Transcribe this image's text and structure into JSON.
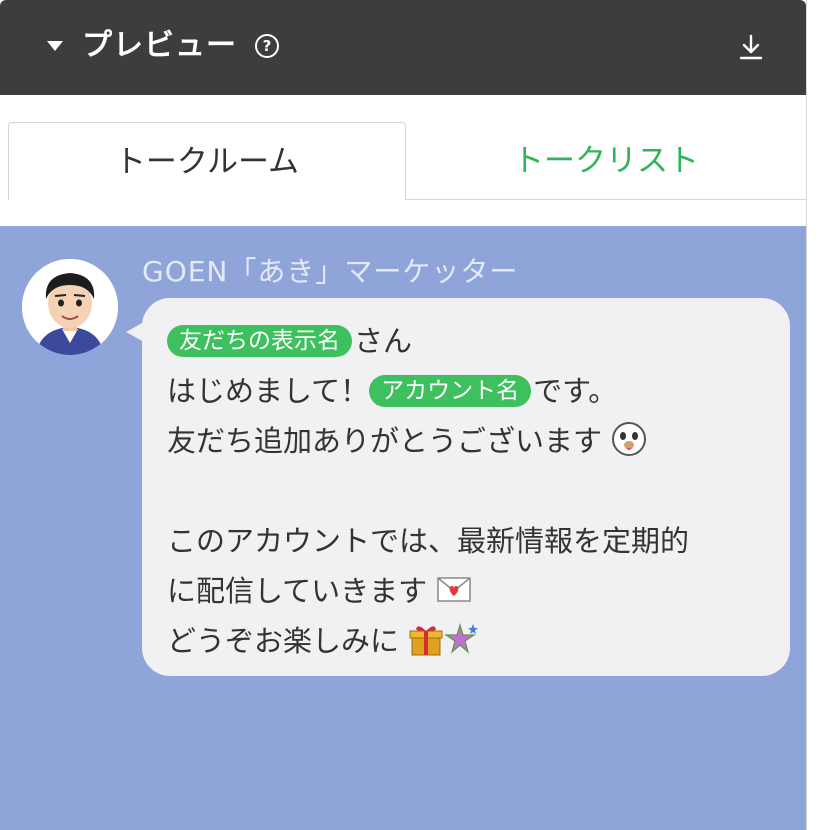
{
  "header": {
    "title": "プレビュー",
    "help_glyph": "?",
    "icons": {
      "collapse": "caret-down-icon",
      "help": "help-circle-icon",
      "download": "download-icon"
    }
  },
  "tabs": [
    {
      "label": "トークルーム",
      "active": true
    },
    {
      "label": "トークリスト",
      "active": false
    }
  ],
  "chat": {
    "sender": "GOEN「あき」マーケッター",
    "background": "#8fa4d8",
    "message": {
      "line1_tag": "友だちの表示名",
      "line1_text": "さん",
      "line2_pre": "はじめまして！",
      "line2_tag": "アカウント名",
      "line2_post": "です。",
      "line3": "友だち追加ありがとうございます",
      "line4": "このアカウントでは、最新情報を定期的",
      "line5": "に配信していきます",
      "line6": "どうぞお楽しみに",
      "emojis": [
        "brown-bear-face-icon",
        "love-letter-icon",
        "gift-icon",
        "sparkle-star-icon"
      ]
    }
  },
  "colors": {
    "header_bg": "#3d3d3d",
    "accent_green": "#2fb457",
    "tag_green": "#3ec05f",
    "bubble_bg": "#f1f1f4"
  }
}
